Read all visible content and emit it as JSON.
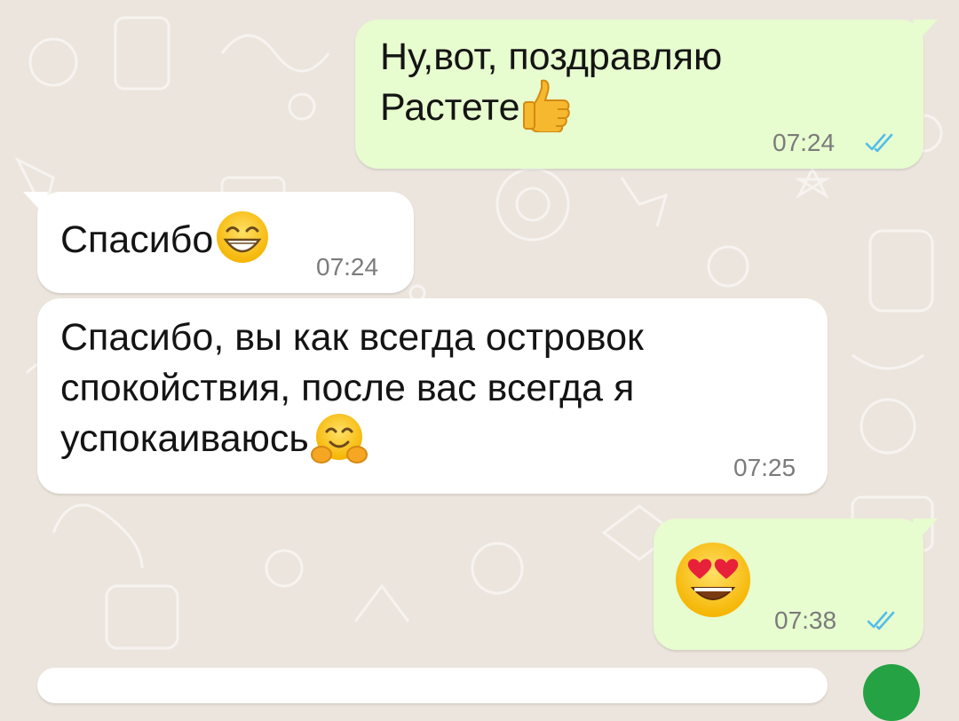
{
  "theme": {
    "background": "#ece5dd",
    "outgoing_bubble": "#e7fccf",
    "incoming_bubble": "#ffffff",
    "read_ticks_color": "#53bdeb"
  },
  "messages": [
    {
      "direction": "outgoing",
      "lines": [
        "Ну,вот, поздравляю",
        "Растете"
      ],
      "emoji": "thumbs-up",
      "time": "07:24",
      "status": "read"
    },
    {
      "direction": "incoming",
      "lines": [
        "Спасибо"
      ],
      "emoji": "grinning-face-with-smiling-eyes",
      "time": "07:24"
    },
    {
      "direction": "incoming",
      "lines": [
        "Спасибо, вы как всегда островок",
        "спокойствия, после вас всегда я",
        "успокаиваюсь"
      ],
      "emoji": "hugging-face",
      "time": "07:25"
    },
    {
      "direction": "outgoing",
      "lines": [],
      "emoji": "smiling-face-with-heart-eyes",
      "time": "07:38",
      "status": "read"
    }
  ]
}
